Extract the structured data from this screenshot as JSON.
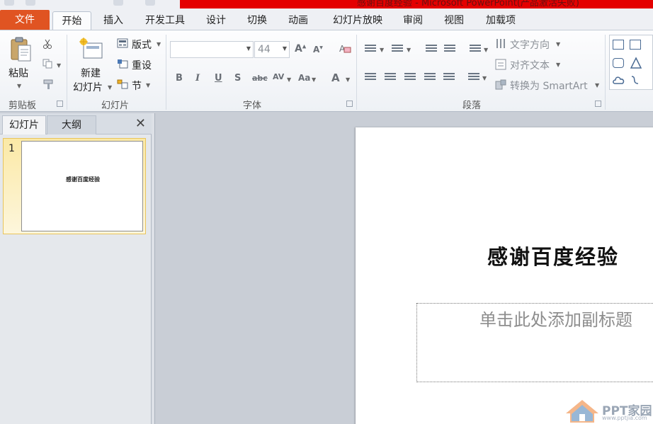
{
  "window": {
    "title": "感谢百度经验 - Microsoft PowerPoint(产品激活失败)"
  },
  "tabs": [
    {
      "label": "文件",
      "id": "file"
    },
    {
      "label": "开始",
      "id": "home",
      "active": true
    },
    {
      "label": "插入",
      "id": "insert"
    },
    {
      "label": "开发工具",
      "id": "developer"
    },
    {
      "label": "设计",
      "id": "design"
    },
    {
      "label": "切换",
      "id": "transitions"
    },
    {
      "label": "动画",
      "id": "animations"
    },
    {
      "label": "幻灯片放映",
      "id": "slideshow"
    },
    {
      "label": "审阅",
      "id": "review"
    },
    {
      "label": "视图",
      "id": "view"
    },
    {
      "label": "加载项",
      "id": "addins"
    }
  ],
  "ribbon": {
    "clipboard": {
      "paste_label": "粘贴",
      "group_label": "剪贴板"
    },
    "slides": {
      "new_slide_line1": "新建",
      "new_slide_line2": "幻灯片",
      "layout_label": "版式",
      "reset_label": "重设",
      "section_label": "节",
      "group_label": "幻灯片"
    },
    "font": {
      "font_name": "",
      "font_size": "44",
      "group_label": "字体"
    },
    "paragraph": {
      "text_direction_label": "文字方向",
      "align_text_label": "对齐文本",
      "smartart_label": "转换为 SmartArt",
      "group_label": "段落"
    }
  },
  "pane": {
    "tab_slides": "幻灯片",
    "tab_outline": "大纲",
    "close_glyph": "✕",
    "thumbnails": [
      {
        "number": "1",
        "title": "感谢百度经验"
      }
    ]
  },
  "slide": {
    "title": "感谢百度经验",
    "subtitle_placeholder": "单击此处添加副标题"
  },
  "watermark": {
    "text": "PPT家园",
    "url": "www.pptjia.com"
  },
  "colors": {
    "file_tab": "#e05422",
    "title_bar_accent": "#e40000",
    "selected_thumb": "#fbe9a6"
  }
}
